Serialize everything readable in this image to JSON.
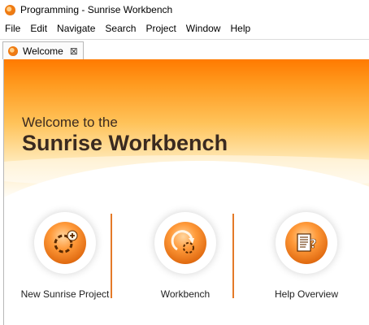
{
  "window": {
    "title": "Programming - Sunrise Workbench"
  },
  "menu": [
    "File",
    "Edit",
    "Navigate",
    "Search",
    "Project",
    "Window",
    "Help"
  ],
  "tab": {
    "label": "Welcome",
    "close_glyph": "⊠"
  },
  "hero": {
    "line1": "Welcome to the",
    "title": "Sunrise Workbench"
  },
  "actions": [
    {
      "label": "New Sunrise Project",
      "icon": "new-project-icon"
    },
    {
      "label": "Workbench",
      "icon": "workbench-icon"
    },
    {
      "label": "Help Overview",
      "icon": "help-overview-icon"
    }
  ],
  "colors": {
    "accent": "#ff8a00",
    "separator": "#e47a28",
    "heading": "#3a2a20"
  }
}
